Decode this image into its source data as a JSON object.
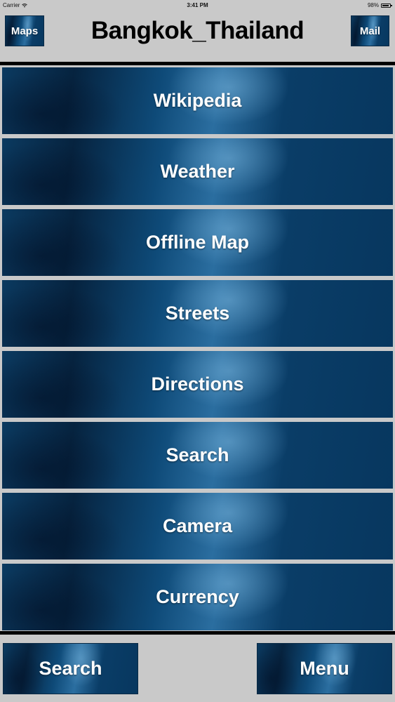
{
  "status_bar": {
    "carrier": "Carrier",
    "time": "3:41 PM",
    "battery": "98%"
  },
  "header": {
    "title": "Bangkok_Thailand",
    "left_button": "Maps",
    "right_button": "Mail"
  },
  "menu": {
    "items": [
      {
        "label": "Wikipedia"
      },
      {
        "label": "Weather"
      },
      {
        "label": "Offline Map"
      },
      {
        "label": "Streets"
      },
      {
        "label": "Directions"
      },
      {
        "label": "Search"
      },
      {
        "label": "Camera"
      },
      {
        "label": "Currency"
      }
    ]
  },
  "footer": {
    "left_button": "Search",
    "right_button": "Menu"
  },
  "colors": {
    "background": "#c9c9c9",
    "tile_dark": "#06233f",
    "tile_light": "#2b6ea0",
    "divider": "#000000"
  },
  "icons": {
    "wifi": "wifi-icon",
    "battery": "battery-icon"
  }
}
